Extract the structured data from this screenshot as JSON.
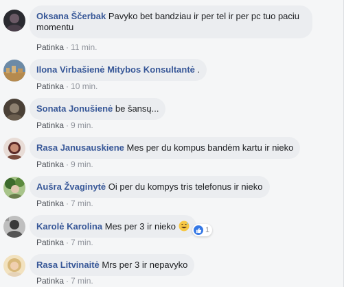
{
  "comments": [
    {
      "author": "Oksana Ščerbak",
      "text": "Pavyko bet bandziau ir per tel ir per pc tuo paciu momentu",
      "like_label": "Patinka",
      "time": "11 min.",
      "avatar_colors": [
        "#2a2a30",
        "#6b5a66"
      ]
    },
    {
      "author": "Ilona Virbašienė Mitybos Konsultantė",
      "text": ".",
      "like_label": "Patinka",
      "time": "10 min.",
      "avatar_colors": [
        "#6c8aa6",
        "#c9a46a"
      ]
    },
    {
      "author": "Sonata Jonušienė",
      "text": "be šansų...",
      "like_label": "Patinka",
      "time": "9 min.",
      "avatar_colors": [
        "#4a4036",
        "#8f8170"
      ]
    },
    {
      "author": "Rasa Janusauskiene",
      "text": "Mes per du kompus bandėm kartu ir nieko",
      "like_label": "Patinka",
      "time": "9 min.",
      "avatar_colors": [
        "#5b2a28",
        "#c78d76"
      ]
    },
    {
      "author": "Aušra Žvaginytė",
      "text": "Oi per du kompys tris telefonus ir nieko",
      "like_label": "Patinka",
      "time": "7 min.",
      "avatar_colors": [
        "#3c6a2c",
        "#a8c48a"
      ]
    },
    {
      "author": "Karolė Karolina",
      "text": "Mes per 3 ir nieko",
      "like_label": "Patinka",
      "time": "7 min.",
      "reaction_count": "1",
      "avatar_colors": [
        "#3a3a3a",
        "#bfbfbf"
      ]
    },
    {
      "author": "Rasa Litvinaitė",
      "text": "Mrs per 3 ir nepavyko",
      "like_label": "Patinka",
      "time": "7 min.",
      "avatar_colors": [
        "#d8b87a",
        "#f2e2bf"
      ]
    }
  ],
  "colors": {
    "author": "#385898",
    "bubble": "#ebedf0",
    "meta": "#90949c",
    "like_badge": "#3578e5"
  },
  "icons": {
    "emoji": "grinning-sweat-emoji-icon",
    "reaction": "thumbs-up-icon"
  }
}
